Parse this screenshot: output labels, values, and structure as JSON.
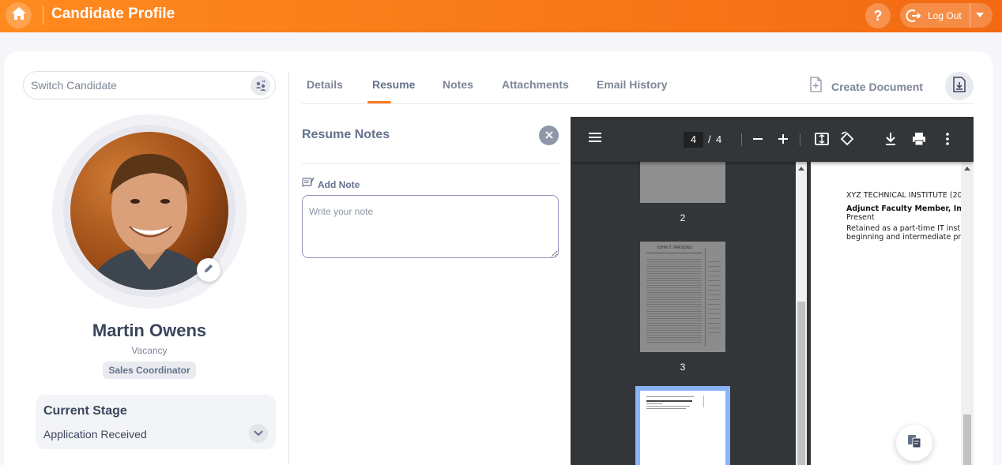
{
  "header": {
    "title": "Candidate Profile",
    "help_label": "?",
    "logout_label": "Log Out",
    "accent_color": "#f7781a"
  },
  "left": {
    "switch_candidate_placeholder": "Switch Candidate",
    "candidate_name": "Martin Owens",
    "vacancy_label": "Vacancy",
    "vacancy_value": "Sales Coordinator",
    "stage_title": "Current Stage",
    "stage_value": "Application Received"
  },
  "tabs": {
    "items": [
      "Details",
      "Resume",
      "Notes",
      "Attachments",
      "Email History"
    ],
    "active": "Resume",
    "create_document_label": "Create Document"
  },
  "notes": {
    "title": "Resume Notes",
    "add_note_label": "Add Note",
    "placeholder": "Write your note"
  },
  "pdf_viewer": {
    "current_page": "4",
    "page_separator": "/",
    "total_pages": "4",
    "thumbnails": [
      "2",
      "3"
    ],
    "page_text": {
      "line1": "XYZ TECHNICAL INSTITUTE (20",
      "line2": "Adjunct Faculty Member, In",
      "line3": "Present",
      "line4": "Retained as a part-time IT inst",
      "line5": "beginning and intermediate pr"
    },
    "thumb_page3_heading": "JOHN T. PARSONS"
  },
  "icons": {
    "home": "home-icon",
    "logout": "logout-icon",
    "switch": "switch-users-icon",
    "edit": "pencil-icon",
    "create_document": "file-plus-icon",
    "download": "download-file-icon",
    "close": "close-icon",
    "note": "note-icon",
    "menu": "menu-icon",
    "zoom_out": "minus-icon",
    "zoom_in": "plus-icon",
    "fit": "fit-page-icon",
    "rotate": "rotate-icon",
    "pdf_download": "download-icon",
    "print": "print-icon",
    "more": "more-vertical-icon",
    "fab": "documents-icon"
  }
}
